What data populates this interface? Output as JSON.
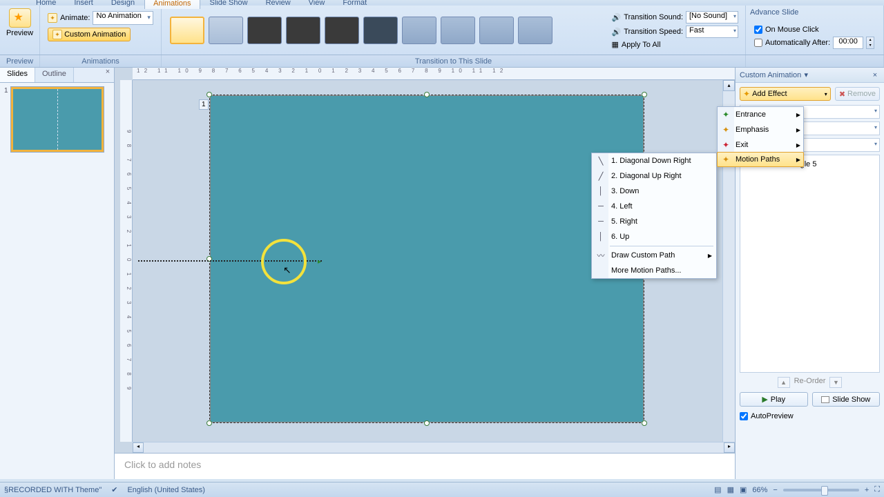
{
  "tabs": {
    "home": "Home",
    "insert": "Insert",
    "design": "Design",
    "animations": "Animations",
    "slideshow": "Slide Show",
    "review": "Review",
    "view": "View",
    "format": "Format"
  },
  "ribbon": {
    "preview": "Preview",
    "animate_label": "Animate:",
    "animate_value": "No Animation",
    "custom_animation": "Custom Animation",
    "trans_sound_label": "Transition Sound:",
    "trans_sound_value": "[No Sound]",
    "trans_speed_label": "Transition Speed:",
    "trans_speed_value": "Fast",
    "apply_all": "Apply To All",
    "advance_title": "Advance Slide",
    "on_click": "On Mouse Click",
    "auto_after": "Automatically After:",
    "auto_time": "00:00",
    "group_preview": "Preview",
    "group_anim": "Animations",
    "group_trans": "Transition to This Slide"
  },
  "left": {
    "tab_slides": "Slides",
    "tab_outline": "Outline",
    "slide_num": "1"
  },
  "pane": {
    "title": "Custom Animation",
    "add_effect": "Add Effect",
    "remove": "Remove",
    "reorder": "Re-Order",
    "play": "Play",
    "slideshow": "Slide Show",
    "autopreview": "AutoPreview",
    "item_num": "1",
    "item_name": "Rectangle 5"
  },
  "effect_menu": {
    "entrance": "Entrance",
    "emphasis": "Emphasis",
    "exit": "Exit",
    "motion": "Motion Paths"
  },
  "submenu": {
    "i1": "1. Diagonal Down Right",
    "i2": "2. Diagonal Up Right",
    "i3": "3. Down",
    "i4": "4. Left",
    "i5": "5. Right",
    "i6": "6. Up",
    "draw": "Draw Custom Path",
    "more": "More Motion Paths..."
  },
  "notes_placeholder": "Click to add notes",
  "status": {
    "rec": "§RECORDED WITH Theme\"",
    "lang": "English (United States)",
    "zoom": "66%"
  },
  "ruler_h": "12 11 10  9  8  7  6  5  4  3  2  1  0  1  2  3  4  5  6  7  8  9 10 11 12",
  "ruler_v": "9 8 7 6 5 4 3 2 1 0 1 2 3 4 5 6 7 8 9",
  "slide_index": "1"
}
